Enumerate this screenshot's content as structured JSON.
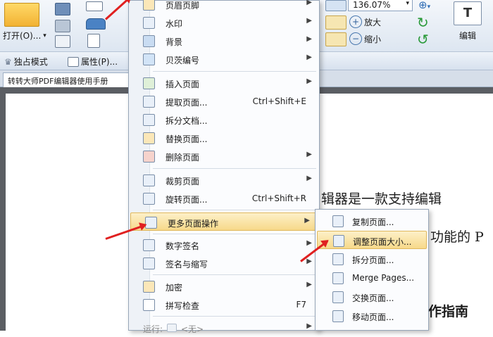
{
  "ribbon": {
    "open_label": "打开(O)...",
    "zoom_value": "136.07%",
    "zoom_in_label": "放大",
    "zoom_out_label": "缩小",
    "edit_label": "编辑"
  },
  "quickbar": {
    "exclusive_mode_label": "独占模式",
    "properties_label": "属性(P)..."
  },
  "doc_tab": {
    "title": "转转大师PDF编辑器使用手册"
  },
  "document": {
    "line1": "辑器是一款支持编辑",
    "line2": "功能的 P",
    "heading": "作指南"
  },
  "context_menu": {
    "items": [
      {
        "label": "页眉页脚",
        "icon": "header-footer-icon",
        "has_submenu": true
      },
      {
        "label": "水印",
        "icon": "watermark-icon",
        "has_submenu": true
      },
      {
        "label": "背景",
        "icon": "background-icon",
        "has_submenu": true
      },
      {
        "label": "贝茨编号",
        "icon": "bates-number-icon",
        "has_submenu": true
      },
      {
        "label": "插入页面",
        "icon": "insert-page-icon",
        "has_submenu": true
      },
      {
        "label": "提取页面...",
        "icon": "extract-page-icon",
        "shortcut": "Ctrl+Shift+E"
      },
      {
        "label": "拆分文档...",
        "icon": "split-document-icon"
      },
      {
        "label": "替换页面...",
        "icon": "replace-page-icon"
      },
      {
        "label": "删除页面",
        "icon": "delete-page-icon",
        "has_submenu": true
      },
      {
        "label": "裁剪页面",
        "icon": "crop-page-icon",
        "has_submenu": true
      },
      {
        "label": "旋转页面...",
        "icon": "rotate-page-icon",
        "shortcut": "Ctrl+Shift+R"
      },
      {
        "label": "更多页面操作",
        "icon": "more-page-ops-icon",
        "has_submenu": true,
        "highlighted": true
      },
      {
        "label": "数字签名",
        "icon": "digital-signature-icon",
        "has_submenu": true
      },
      {
        "label": "签名与缩写",
        "icon": "sign-initials-icon",
        "has_submenu": true
      },
      {
        "label": "加密",
        "icon": "encrypt-icon",
        "has_submenu": true
      },
      {
        "label": "拼写检查",
        "icon": "spell-check-icon",
        "shortcut": "F7"
      },
      {
        "label": "运行:",
        "icon": "run-icon",
        "shortcut": "<无>",
        "disabled": true
      }
    ]
  },
  "submenu": {
    "items": [
      {
        "label": "复制页面...",
        "icon": "copy-page-icon"
      },
      {
        "label": "调整页面大小...",
        "icon": "resize-page-icon",
        "highlighted": true
      },
      {
        "label": "拆分页面...",
        "icon": "split-page-icon"
      },
      {
        "label": "Merge Pages...",
        "icon": "merge-pages-icon"
      },
      {
        "label": "交换页面...",
        "icon": "swap-pages-icon"
      },
      {
        "label": "移动页面...",
        "icon": "move-page-icon"
      }
    ]
  },
  "colors": {
    "highlight": "#f7d98a",
    "annotation_arrow": "#e02020"
  }
}
